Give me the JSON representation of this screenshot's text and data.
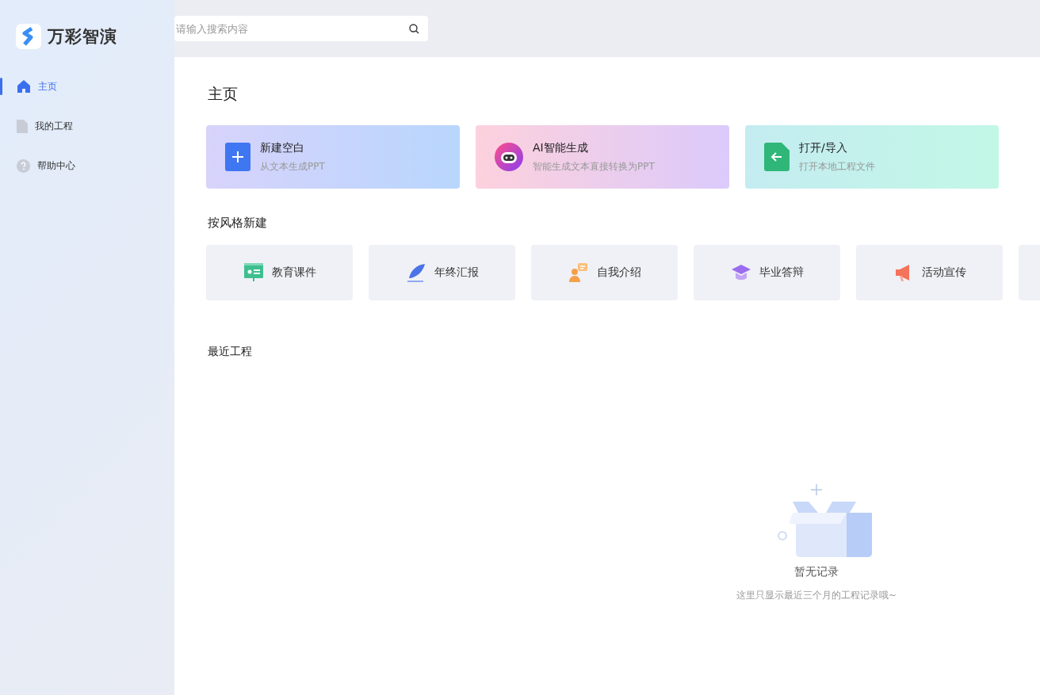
{
  "app": {
    "name": "万彩智演"
  },
  "search": {
    "placeholder": "请输入搜索内容"
  },
  "sidebar": {
    "items": [
      {
        "label": "主页",
        "kind": "home",
        "selected": true
      },
      {
        "label": "我的工程",
        "kind": "file",
        "selected": false
      },
      {
        "label": "帮助中心",
        "kind": "help",
        "selected": false
      }
    ]
  },
  "page_title": "主页",
  "actions": [
    {
      "kind": "new",
      "title": "新建空白",
      "subtitle": "从文本生成PPT"
    },
    {
      "kind": "ai",
      "title": "AI智能生成",
      "subtitle": "智能生成文本直接转换为PPT"
    },
    {
      "kind": "open",
      "title": "打开/导入",
      "subtitle": "打开本地工程文件"
    }
  ],
  "styles_heading": "按风格新建",
  "styles": [
    {
      "kind": "education",
      "label": "教育课件"
    },
    {
      "kind": "report",
      "label": "年终汇报"
    },
    {
      "kind": "intro",
      "label": "自我介绍"
    },
    {
      "kind": "graduation",
      "label": "毕业答辩"
    },
    {
      "kind": "promo",
      "label": "活动宣传"
    }
  ],
  "recent": {
    "heading": "最近工程",
    "empty_title": "暂无记录",
    "empty_hint": "这里只显示最近三个月的工程记录哦~"
  }
}
